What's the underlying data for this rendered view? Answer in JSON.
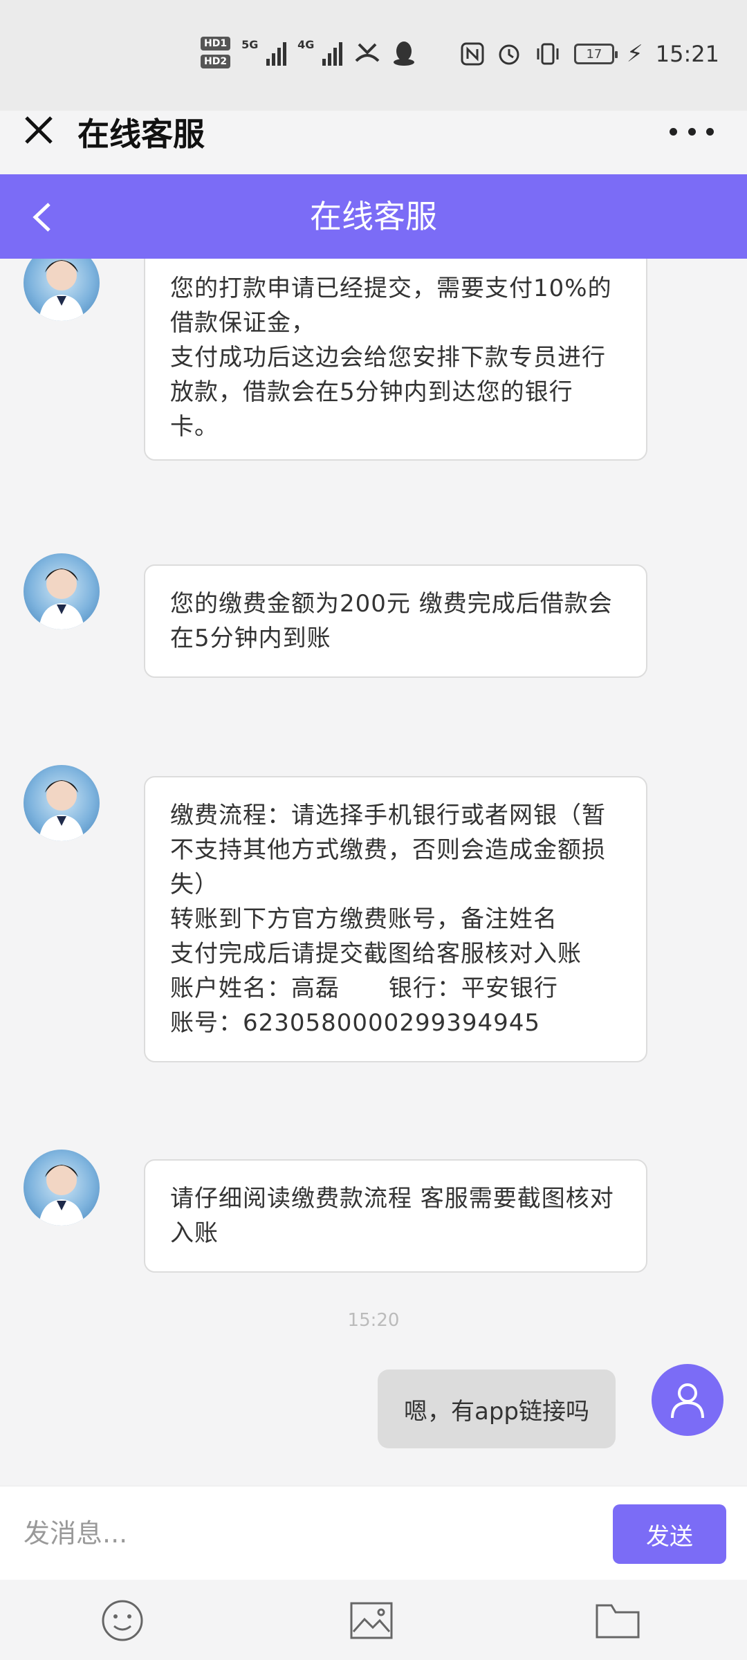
{
  "status_bar": {
    "hd1": "HD1",
    "hd2": "HD2",
    "net1": "5G",
    "net2": "4G",
    "battery": "17",
    "time": "15:21"
  },
  "top_bar": {
    "title": "在线客服"
  },
  "chat_header": {
    "title": "在线客服"
  },
  "messages": [
    {
      "text": "您的打款申请已经提交，需要支付10%的借款保证金，\n支付成功后这边会给您安排下款专员进行放款，借款会在5分钟内到达您的银行卡。"
    },
    {
      "text": "您的缴费金额为200元 缴费完成后借款会在5分钟内到账"
    },
    {
      "text": "缴费流程：请选择手机银行或者网银（暂不支持其他方式缴费，否则会造成金额损失）\n转账到下方官方缴费账号，备注姓名\n支付完成后请提交截图给客服核对入账\n账户姓名：高磊      银行：平安银行\n账号：6230580000299394945"
    },
    {
      "text": "请仔细阅读缴费款流程 客服需要截图核对入账"
    }
  ],
  "timestamp": "15:20",
  "my_message": "嗯，有app链接吗",
  "input": {
    "placeholder": "发消息...",
    "send_label": "发送"
  },
  "colors": {
    "accent": "#7b6cf6",
    "bubble_user": "#dcdcdc"
  },
  "toolbar_icons": [
    "emoji-icon",
    "image-icon",
    "folder-icon"
  ]
}
